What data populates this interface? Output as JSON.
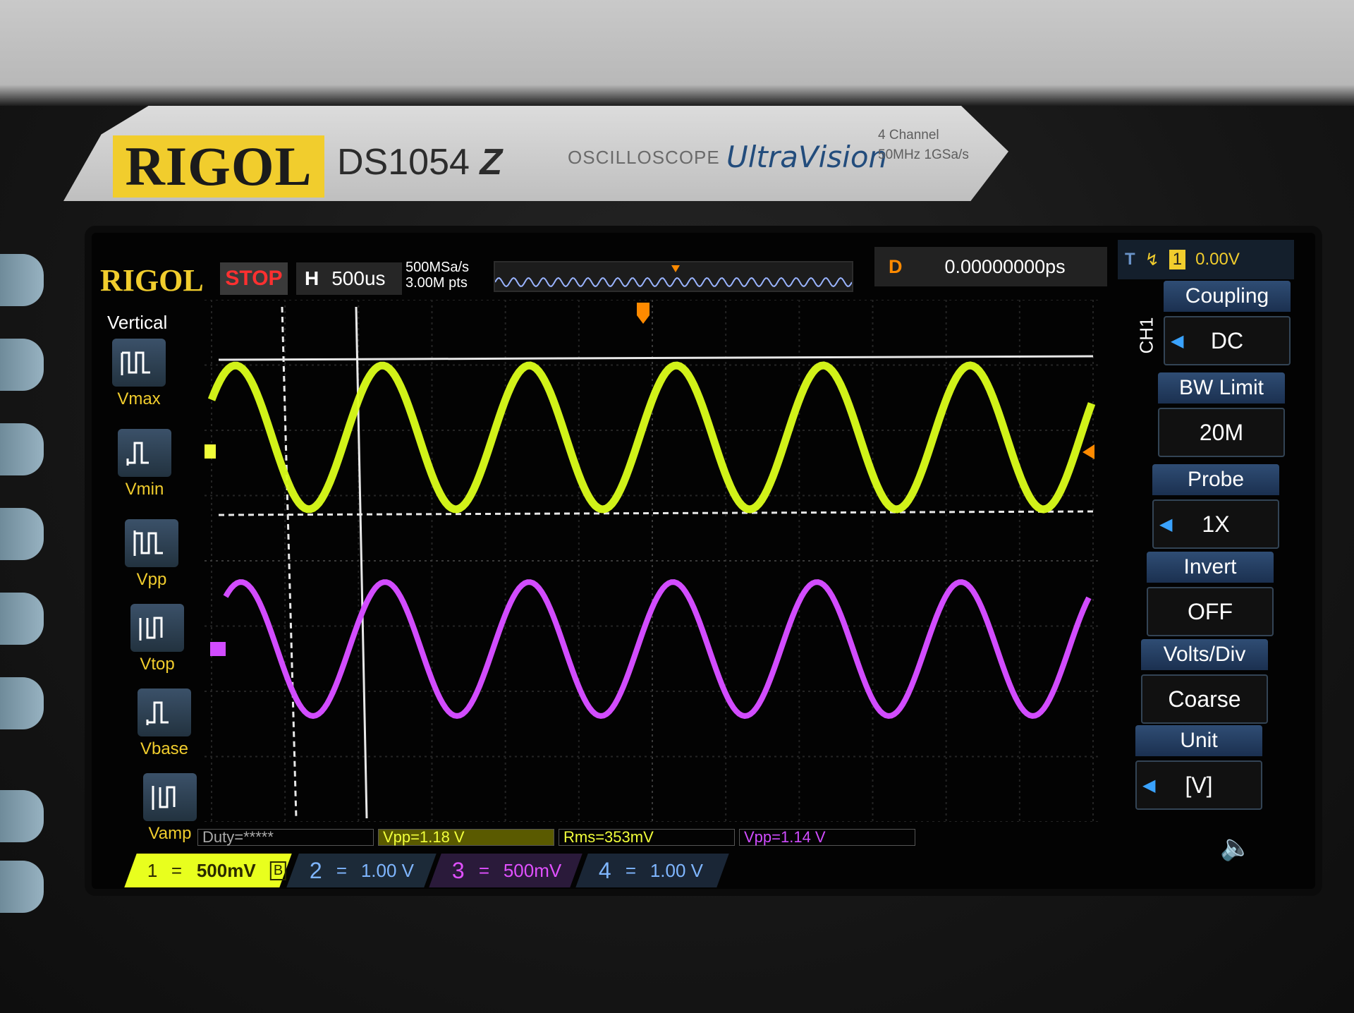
{
  "device": {
    "brand": "RIGOL",
    "model": "DS1054",
    "model_suffix": "Z",
    "type_label": "OSCILLOSCOPE",
    "series": "UltraVision",
    "spec_line1": "4 Channel",
    "spec_line2": "50MHz  1GSa/s"
  },
  "top_bar": {
    "logo": "RIGOL",
    "run_status": "STOP",
    "horizontal_label": "H",
    "timebase": "500us",
    "sample_rate": "500MSa/s",
    "memory_depth": "3.00M pts",
    "delay_label": "D",
    "delay_value": "0.00000000ps",
    "trigger_label": "T",
    "trigger_level": "0.00V"
  },
  "measure_panel": {
    "title": "Vertical",
    "items": [
      {
        "label": "Vmax",
        "icon": "vmax-icon"
      },
      {
        "label": "Vmin",
        "icon": "vmin-icon"
      },
      {
        "label": "Vpp",
        "icon": "vpp-icon"
      },
      {
        "label": "Vtop",
        "icon": "vtop-icon"
      },
      {
        "label": "Vbase",
        "icon": "vbase-icon"
      },
      {
        "label": "Vamp",
        "icon": "vamp-icon"
      }
    ]
  },
  "right_menu": {
    "channel": "CH1",
    "items": [
      {
        "title": "Coupling",
        "value": "DC",
        "arrow": true
      },
      {
        "title": "BW Limit",
        "value": "20M",
        "arrow": false
      },
      {
        "title": "Probe",
        "value": "1X",
        "arrow": true
      },
      {
        "title": "Invert",
        "value": "OFF",
        "arrow": false
      },
      {
        "title": "Volts/Div",
        "value": "Coarse",
        "arrow": false
      },
      {
        "title": "Unit",
        "value": "[V]",
        "arrow": true
      }
    ]
  },
  "measurements": {
    "duty": "Duty=*****",
    "vpp_ch1": "Vpp=1.18 V",
    "rms_ch1": "Rms=353mV",
    "vpp_ch3": "Vpp=1.14 V"
  },
  "channels": [
    {
      "num": "1",
      "coupling": "=",
      "scale": "500mV",
      "extra": "B",
      "color": "#e8ff1e"
    },
    {
      "num": "2",
      "coupling": "=",
      "scale": "1.00 V",
      "color": "#7fb6ff"
    },
    {
      "num": "3",
      "coupling": "=",
      "scale": "500mV",
      "color": "#e050ff"
    },
    {
      "num": "4",
      "coupling": "=",
      "scale": "1.00 V",
      "color": "#7fb6ff"
    }
  ],
  "waveforms": {
    "ch1_color": "#dcff1a",
    "ch3_color": "#d24cff",
    "cycles_visible": 6
  }
}
